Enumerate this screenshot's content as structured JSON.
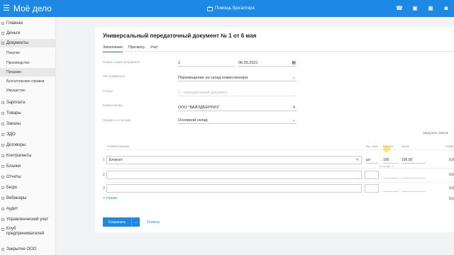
{
  "header": {
    "logo": "Моё дело",
    "help": "Помощь бухгалтера",
    "icons": [
      "phone-icon",
      "chat-icon",
      "calendar-icon",
      "user-icon"
    ],
    "accent": "#1e88e5"
  },
  "sidebar": {
    "items": [
      {
        "label": "Главная",
        "icon": "home-icon"
      },
      {
        "label": "Деньги",
        "icon": "money-icon"
      },
      {
        "label": "Документы",
        "icon": "documents-icon"
      },
      {
        "label": "Покупки"
      },
      {
        "label": "Производство"
      },
      {
        "label": "Продажи"
      },
      {
        "label": "Бухгалтерские справки"
      },
      {
        "label": "Имущество"
      },
      {
        "label": "Зарплата",
        "icon": "salary-icon"
      },
      {
        "label": "Товары",
        "icon": "goods-icon"
      },
      {
        "label": "Заказы",
        "icon": "orders-icon"
      },
      {
        "label": "ЭДО",
        "icon": "edo-icon"
      },
      {
        "label": "Договоры",
        "icon": "contracts-icon"
      },
      {
        "label": "Контрагенты",
        "icon": "contractors-icon"
      },
      {
        "label": "Бланки",
        "icon": "forms-icon"
      },
      {
        "label": "Отчеты",
        "icon": "reports-icon"
      },
      {
        "label": "Бюро",
        "icon": "bureau-icon"
      },
      {
        "label": "Вебинары",
        "icon": "webinar-icon"
      },
      {
        "label": "Аудит",
        "icon": "audit-icon"
      },
      {
        "label": "Управленческий учет",
        "icon": "management-icon"
      },
      {
        "label": "Клуб предпринимателей",
        "icon": "club-icon"
      },
      {
        "label": "Закрытие ООО",
        "icon": "close-company-icon"
      }
    ]
  },
  "doc": {
    "title": "Универсальный передаточный документ № 1 от 6 мая",
    "tabs": [
      "Заполнение",
      "Просмотр",
      "Учет"
    ],
    "fields": {
      "number_label": "Номер и дата документа",
      "number": "1",
      "date": "06.05.2021",
      "type_label": "Тип документа",
      "type": "Перемещение на склад комиссионера",
      "status_label": "Статус",
      "status": "2 - передаточный документ",
      "commissioner_label": "Комиссионер",
      "commissioner": "ООО \"ВАЙЛДБЕРРИЗ\"",
      "warehouse_label": "Продать со склада",
      "warehouse": "Основной склад"
    },
    "load_list": "Загрузить список",
    "table": {
      "headers": {
        "name": "Наименование",
        "unit": "Ед. изм.",
        "qty": "Кол-во",
        "price": "Цена",
        "sum": "Сумм"
      },
      "rows": [
        {
          "num": "1",
          "name": "Блокнот",
          "unit": "шт",
          "qty": "100",
          "price": "100,00",
          "sum": "0,0",
          "stock_hint": "На складе: 0"
        },
        {
          "num": "2",
          "name": "",
          "unit": "",
          "qty": "",
          "price": "",
          "sum": "0,0"
        },
        {
          "num": "3",
          "name": "",
          "unit": "",
          "qty": "",
          "price": "",
          "sum": "0,0"
        }
      ],
      "add_row": "+ строка",
      "total": "0,0"
    },
    "save": "Сохранить",
    "cancel": "Отмена"
  }
}
